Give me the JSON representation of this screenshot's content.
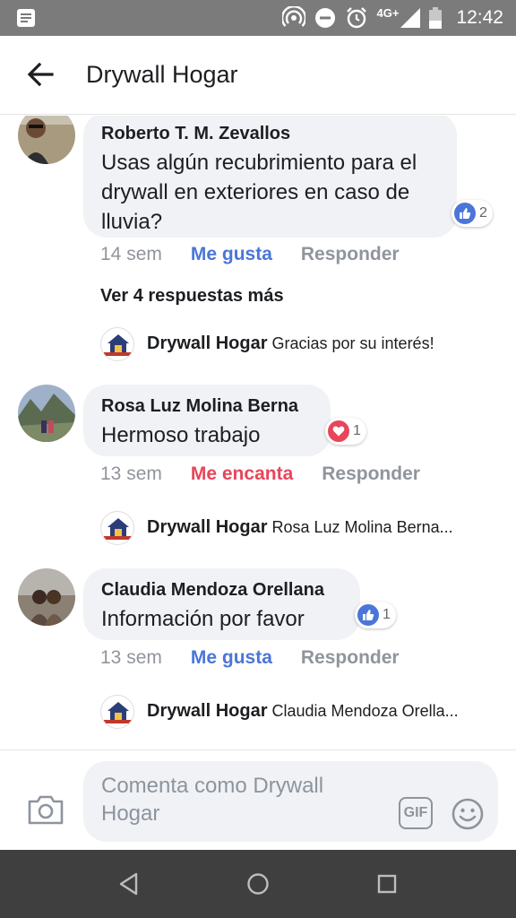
{
  "status_bar": {
    "network": "4G+",
    "time": "12:42"
  },
  "header": {
    "title": "Drywall Hogar"
  },
  "comments": [
    {
      "author": "Roberto T. M. Zevallos",
      "text": "Usas algún recubrimiento para el drywall en exteriores en caso de lluvia?",
      "reaction_count": "2",
      "reaction_type": "like",
      "time": "14 sem",
      "reaction_label": "Me gusta",
      "reply_label": "Responder",
      "more_replies": "Ver 4 respuestas más",
      "reply": {
        "author": "Drywall Hogar",
        "text": "Gracias por su interés!"
      }
    },
    {
      "author": "Rosa Luz Molina Berna",
      "text": "Hermoso trabajo",
      "reaction_count": "1",
      "reaction_type": "love",
      "time": "13 sem",
      "reaction_label": "Me encanta",
      "reply_label": "Responder",
      "reply": {
        "author": "Drywall Hogar",
        "text": "Rosa Luz Molina Berna..."
      }
    },
    {
      "author": "Claudia Mendoza Orellana",
      "text": "Información por favor",
      "reaction_count": "1",
      "reaction_type": "like",
      "time": "13 sem",
      "reaction_label": "Me gusta",
      "reply_label": "Responder",
      "reply": {
        "author": "Drywall Hogar",
        "text": "Claudia Mendoza Orella..."
      }
    }
  ],
  "composer": {
    "placeholder": "Comenta como Drywall Hogar",
    "gif_label": "GIF"
  },
  "icons": {
    "back": "arrow-left-icon",
    "camera": "camera-icon",
    "emoji": "smiley-icon",
    "like": "thumbs-up-icon",
    "love": "heart-icon"
  },
  "colors": {
    "like_blue": "#4a76d9",
    "love_red": "#e8455a",
    "status_bar": "#7b7b7b",
    "nav_bar": "#3f3f3f",
    "bubble": "#f0f2f5"
  }
}
